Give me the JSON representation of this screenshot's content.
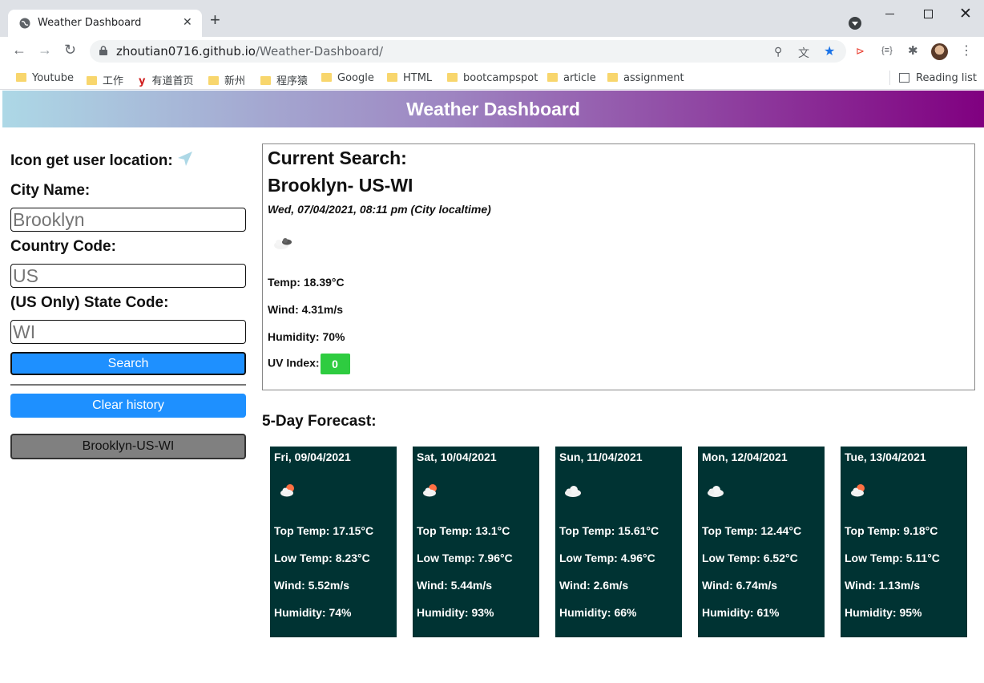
{
  "browser": {
    "tab_title": "Weather Dashboard",
    "url_host": "zhoutian0716.github.io",
    "url_path": "/Weather-Dashboard/",
    "bookmarks": [
      "Youtube",
      "工作",
      "有道首页",
      "新州",
      "程序猿",
      "Google",
      "HTML",
      "bootcampspot",
      "article",
      "assignment"
    ],
    "reading_list": "Reading list"
  },
  "header": {
    "title": "Weather Dashboard"
  },
  "sidebar": {
    "location_label": "Icon get user location:",
    "city_label": "City Name:",
    "city_value": "Brooklyn",
    "country_label": "Country Code:",
    "country_value": "US",
    "state_label": "(US Only) State Code:",
    "state_value": "WI",
    "search_label": "Search",
    "clear_label": "Clear history",
    "history": [
      "Brooklyn-US-WI"
    ]
  },
  "current": {
    "heading": "Current Search:",
    "city": "Brooklyn- US-WI",
    "datetime": "Wed, 07/04/2021, 08:11 pm (City localtime)",
    "icon": "broken-clouds-icon",
    "temp": "Temp: 18.39°C",
    "wind": "Wind: 4.31m/s",
    "humidity": "Humidity: 70%",
    "uv_label": "UV Index:",
    "uv_value": "0",
    "uv_color": "#2ecc40"
  },
  "forecast": {
    "title": "5-Day Forecast:",
    "days": [
      {
        "date": "Fri, 09/04/2021",
        "icon": "partly-cloudy-icon",
        "top": "Top Temp: 17.15°C",
        "low": "Low Temp: 8.23°C",
        "wind": "Wind: 5.52m/s",
        "humidity": "Humidity: 74%"
      },
      {
        "date": "Sat, 10/04/2021",
        "icon": "partly-cloudy-icon",
        "top": "Top Temp: 13.1°C",
        "low": "Low Temp: 7.96°C",
        "wind": "Wind: 5.44m/s",
        "humidity": "Humidity: 93%"
      },
      {
        "date": "Sun, 11/04/2021",
        "icon": "cloudy-icon",
        "top": "Top Temp: 15.61°C",
        "low": "Low Temp: 4.96°C",
        "wind": "Wind: 2.6m/s",
        "humidity": "Humidity: 66%"
      },
      {
        "date": "Mon, 12/04/2021",
        "icon": "cloudy-icon",
        "top": "Top Temp: 12.44°C",
        "low": "Low Temp: 6.52°C",
        "wind": "Wind: 6.74m/s",
        "humidity": "Humidity: 61%"
      },
      {
        "date": "Tue, 13/04/2021",
        "icon": "partly-cloudy-icon",
        "top": "Top Temp: 9.18°C",
        "low": "Low Temp: 5.11°C",
        "wind": "Wind: 1.13m/s",
        "humidity": "Humidity: 95%"
      }
    ]
  },
  "colors": {
    "header_start": "#add8e6",
    "header_end": "#800080",
    "button": "#1e90ff",
    "card": "#003333"
  }
}
